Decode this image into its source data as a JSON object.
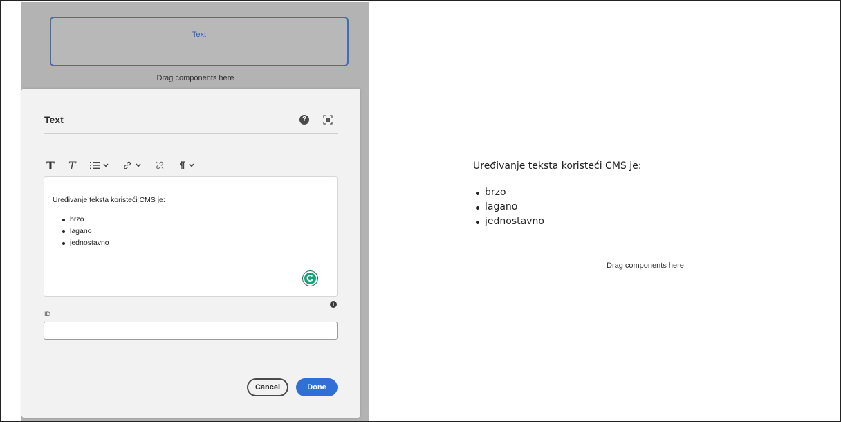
{
  "canvas": {
    "text_placeholder_label": "Text",
    "drag_hint": "Drag components here"
  },
  "dialog": {
    "title": "Text",
    "header_icons": [
      "help-icon",
      "fullscreen-icon"
    ],
    "toolbar": {
      "items": [
        "format-bold-icon",
        "format-italic-icon",
        "list-icon",
        "link-icon",
        "unlink-icon",
        "paragraph-icon"
      ]
    },
    "editor": {
      "intro": "Uređivanje teksta koristeći CMS je:",
      "items": [
        "brzo",
        "lagano",
        "jednostavno"
      ]
    },
    "id_field": {
      "label": "ID",
      "value": "",
      "placeholder": ""
    },
    "cancel_label": "Cancel",
    "done_label": "Done",
    "colors": {
      "accent": "#2f6fd6",
      "grammarly": "#15a37a"
    }
  },
  "preview": {
    "intro": "Uređivanje teksta koristeći CMS je:",
    "items": [
      "brzo",
      "lagano",
      "jednostavno"
    ],
    "drag_hint": "Drag components here"
  }
}
